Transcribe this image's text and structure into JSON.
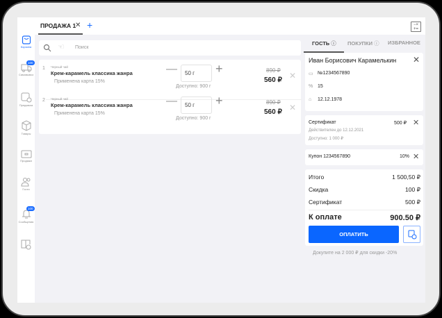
{
  "tabs": {
    "active": "ПРОДАЖА 1"
  },
  "sidebar": [
    {
      "label": "Корзина",
      "icon": "bag-icon"
    },
    {
      "label": "Самовывоз",
      "icon": "truck-icon",
      "badge": "100"
    },
    {
      "label": "Предзаказ",
      "icon": "preorder-icon"
    },
    {
      "label": "Товары",
      "icon": "box-icon"
    },
    {
      "label": "Продажи",
      "icon": "wallet-icon"
    },
    {
      "label": "Гости",
      "icon": "users-icon"
    },
    {
      "label": "Сообщения",
      "icon": "bell-icon",
      "badge": "100"
    },
    {
      "label": "",
      "icon": "book-settings-icon"
    }
  ],
  "search": {
    "placeholder": "Поиск"
  },
  "items": [
    {
      "num": "1",
      "category": "Черный чай",
      "name": "Крем-карамель классика жанра",
      "discount": "Применена карта 15%",
      "qty": "50 г",
      "available": "Доступно: 900 г",
      "old_price": "890 ₽",
      "price": "560 ₽"
    },
    {
      "num": "2",
      "category": "Черный чай",
      "name": "Крем-карамель классика жанра",
      "discount": "Применена карта 15%",
      "qty": "50 г",
      "available": "Доступно: 900 г",
      "old_price": "890 ₽",
      "price": "560 ₽"
    }
  ],
  "right_tabs": [
    "ГОСТЬ",
    "ПОКУПКИ",
    "ИЗБРАННОЕ"
  ],
  "guest": {
    "name": "Иван Борисович Карамелькин",
    "card": "№1234567890",
    "discount": "15",
    "birthday": "12.12.1978"
  },
  "certificate": {
    "label": "Сертификат",
    "amount": "500 ₽",
    "valid": "Действителен до 12.12.2021",
    "available": "Доступно: 1 000 ₽"
  },
  "coupon": {
    "label": "Купон 1234567890",
    "value": "10%"
  },
  "totals": {
    "total_label": "Итого",
    "total": "1 500,50 ₽",
    "discount_label": "Скидка",
    "discount": "100 ₽",
    "cert_label": "Сертификат",
    "cert": "500 ₽",
    "pay_label": "К оплате",
    "pay": "900.50 ₽"
  },
  "pay_button": "ОПЛАТИТЬ",
  "promo": "Докупите на 2 000 ₽ для скидки -20%"
}
